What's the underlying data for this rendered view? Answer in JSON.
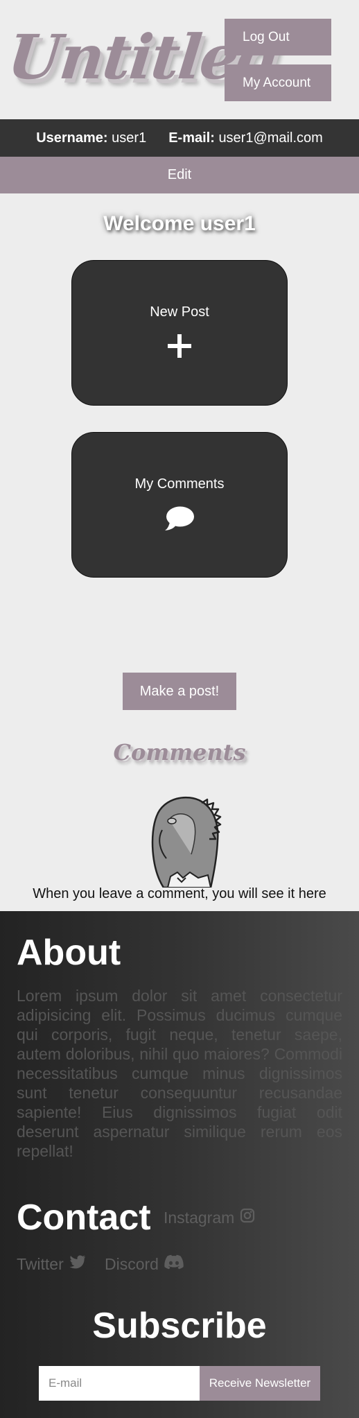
{
  "header": {
    "logo_text": "Untitled",
    "logout_label": "Log Out",
    "account_label": "My Account"
  },
  "userbar": {
    "username_label": "Username:",
    "username_value": "user1",
    "email_label": "E-mail:",
    "email_value": "user1@mail.com",
    "edit_label": "Edit"
  },
  "main": {
    "welcome": "Welcome user1",
    "cards": [
      {
        "label": "New Post",
        "icon": "plus-icon"
      },
      {
        "label": "My Comments",
        "icon": "comment-icon"
      }
    ],
    "make_post_label": "Make a post!",
    "comments_title": "Comments",
    "empty_comments_text": "When you leave a comment, you will see it here"
  },
  "footer": {
    "about_title": "About",
    "about_text": "Lorem ipsum dolor sit amet consectetur adipisicing elit. Possimus ducimus cumque qui corporis, fugit neque, tenetur saepe, autem doloribus, nihil quo maiores? Commodi necessitatibus cumque minus dignissimos sunt tenetur consequuntur recusandae sapiente! Eius dignissimos fugiat odit deserunt aspernatur similique rerum eos repellat!",
    "contact_title": "Contact",
    "social": {
      "instagram": "Instagram",
      "twitter": "Twitter",
      "discord": "Discord"
    },
    "subscribe_title": "Subscribe",
    "email_placeholder": "E-mail",
    "newsletter_label": "Receive Newsletter"
  },
  "colors": {
    "accent": "#9c8c98",
    "dark": "#333333",
    "background": "#ededed"
  }
}
